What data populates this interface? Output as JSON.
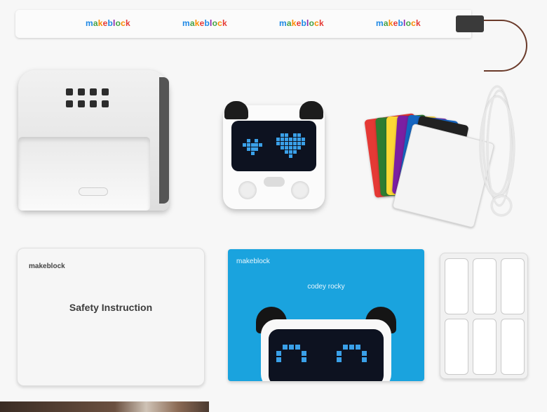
{
  "lanyard": {
    "brand_text": "makeblock",
    "repeat_count": 4
  },
  "safety_booklet": {
    "logo": "makeblock",
    "title": "Safety Instruction"
  },
  "guide_card": {
    "logo": "makeblock",
    "title": "codey rocky"
  },
  "colors": {
    "background": "#f7f7f7",
    "guide_blue": "#1aa3de",
    "pixel_blue": "#3aa0e8",
    "cards": [
      "#e53935",
      "#2e7d32",
      "#fdd835",
      "#7b1fa2",
      "#1565c0",
      "#212121",
      "#f4f4f4"
    ]
  },
  "icons": [
    "heart-eyes-icon",
    "pixel-eyes-icon"
  ]
}
